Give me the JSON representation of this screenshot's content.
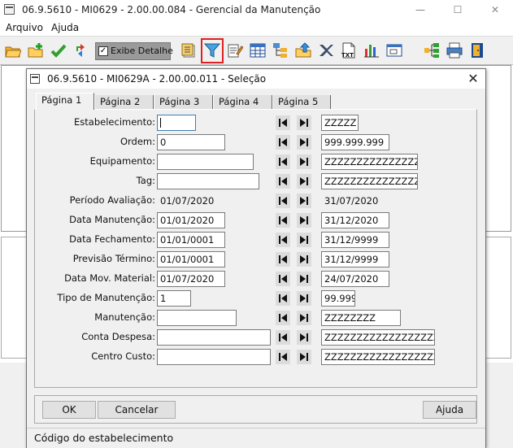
{
  "window": {
    "title": "06.9.5610 - MI0629 - 2.00.00.084 - Gerencial da Manutenção",
    "minimize": "—",
    "maximize": "☐",
    "close": "✕"
  },
  "menu": {
    "items": [
      "Arquivo",
      "Ajuda"
    ]
  },
  "toolbar": {
    "exibe_detalhe_label": "Exibe Detalhe",
    "exibe_detalhe_checked": "✓",
    "icons": [
      "open-folder-icon",
      "new-folder-icon",
      "check-icon",
      "refresh-icon",
      "reports-icon",
      "filter-icon",
      "edit-icon",
      "grid-icon",
      "hierarchy-icon",
      "up-folder-icon",
      "excel-icon",
      "txt-icon",
      "bar-chart-icon",
      "window-icon",
      "tree-icon",
      "print-icon",
      "exit-icon"
    ],
    "txt_label": "TXT",
    "selected_color": "#e02020"
  },
  "dialog": {
    "title": "06.9.5610 - MI0629A - 2.00.00.011 - Seleção",
    "close": "✕",
    "tabs": [
      "Página 1",
      "Página 2",
      "Página 3",
      "Página 4",
      "Página 5"
    ],
    "active_tab": "Página 1",
    "fields": [
      {
        "label": "Estabelecimento:",
        "from": "",
        "to": "ZZZZZ"
      },
      {
        "label": "Ordem:",
        "from": "0",
        "to": "999.999.999"
      },
      {
        "label": "Equipamento:",
        "from": "",
        "to": "ZZZZZZZZZZZZZZZZ"
      },
      {
        "label": "Tag:",
        "from": "",
        "to": "ZZZZZZZZZZZZZZZZ"
      },
      {
        "label": "Período Avaliação:",
        "from": "01/07/2020",
        "to": "31/07/2020"
      },
      {
        "label": "Data Manutenção:",
        "from": "01/01/2020",
        "to": "31/12/2020"
      },
      {
        "label": "Data Fechamento:",
        "from": "01/01/0001",
        "to": "31/12/9999"
      },
      {
        "label": "Previsão Término:",
        "from": "01/01/0001",
        "to": "31/12/9999"
      },
      {
        "label": "Data Mov. Material:",
        "from": "01/07/2020",
        "to": "24/07/2020"
      },
      {
        "label": "Tipo de Manutenção:",
        "from": "1",
        "to": "99.999"
      },
      {
        "label": "Manutenção:",
        "from": "",
        "to": "ZZZZZZZZ"
      },
      {
        "label": "Conta Despesa:",
        "from": "",
        "to": "ZZZZZZZZZZZZZZZZZZZZ"
      },
      {
        "label": "Centro Custo:",
        "from": "",
        "to": "ZZZZZZZZZZZZZZZZZZZZ"
      }
    ],
    "buttons": {
      "ok": "OK",
      "cancel": "Cancelar",
      "help": "Ajuda"
    },
    "status": "Código do estabelecimento"
  }
}
